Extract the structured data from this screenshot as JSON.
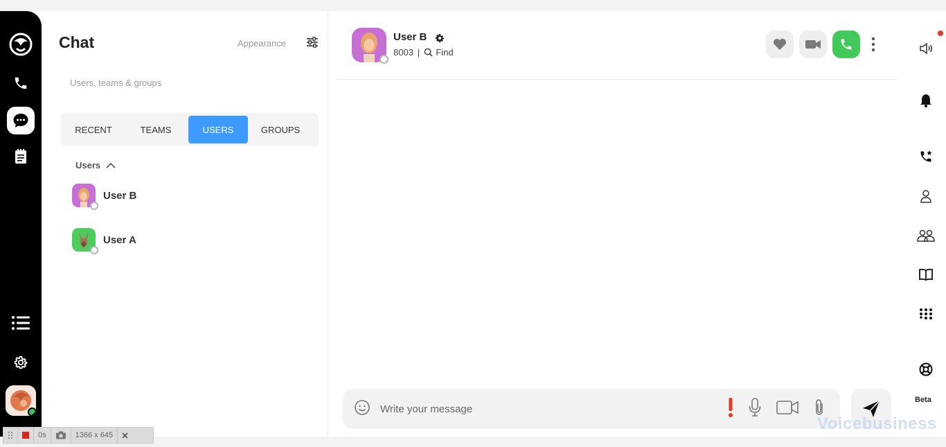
{
  "rail": {
    "items": [
      "logo-icon",
      "phone-icon",
      "chat-icon",
      "notes-icon",
      "list-icon",
      "settings-icon"
    ],
    "active": "chat-icon"
  },
  "panel": {
    "title": "Chat",
    "appearance_label": "Appearance",
    "search_placeholder": "Users, teams & groups",
    "tabs": [
      {
        "label": "RECENT",
        "active": false
      },
      {
        "label": "TEAMS",
        "active": false
      },
      {
        "label": "USERS",
        "active": true
      },
      {
        "label": "GROUPS",
        "active": false
      }
    ],
    "section_label": "Users",
    "users": [
      {
        "name": "User B",
        "avatar_color": "#c86fd6"
      },
      {
        "name": "User A",
        "avatar_color": "#4fcc5e"
      }
    ]
  },
  "chat": {
    "contact_name": "User B",
    "extension": "8003",
    "find_label": "Find",
    "composer_placeholder": "Write your message"
  },
  "right_rail": {
    "items": [
      "speaker-icon",
      "bell-icon",
      "star-call-icon",
      "contact-icon",
      "team-icon",
      "book-icon",
      "dialpad-icon",
      "support-icon"
    ],
    "beta_label": "Beta"
  },
  "watermark": "Voicebusiness",
  "recorder": {
    "time": "0s",
    "size": "1366 x 645"
  },
  "colors": {
    "accent": "#3d9bff",
    "call_green": "#43c95a",
    "alert_red": "#e23a2a"
  }
}
